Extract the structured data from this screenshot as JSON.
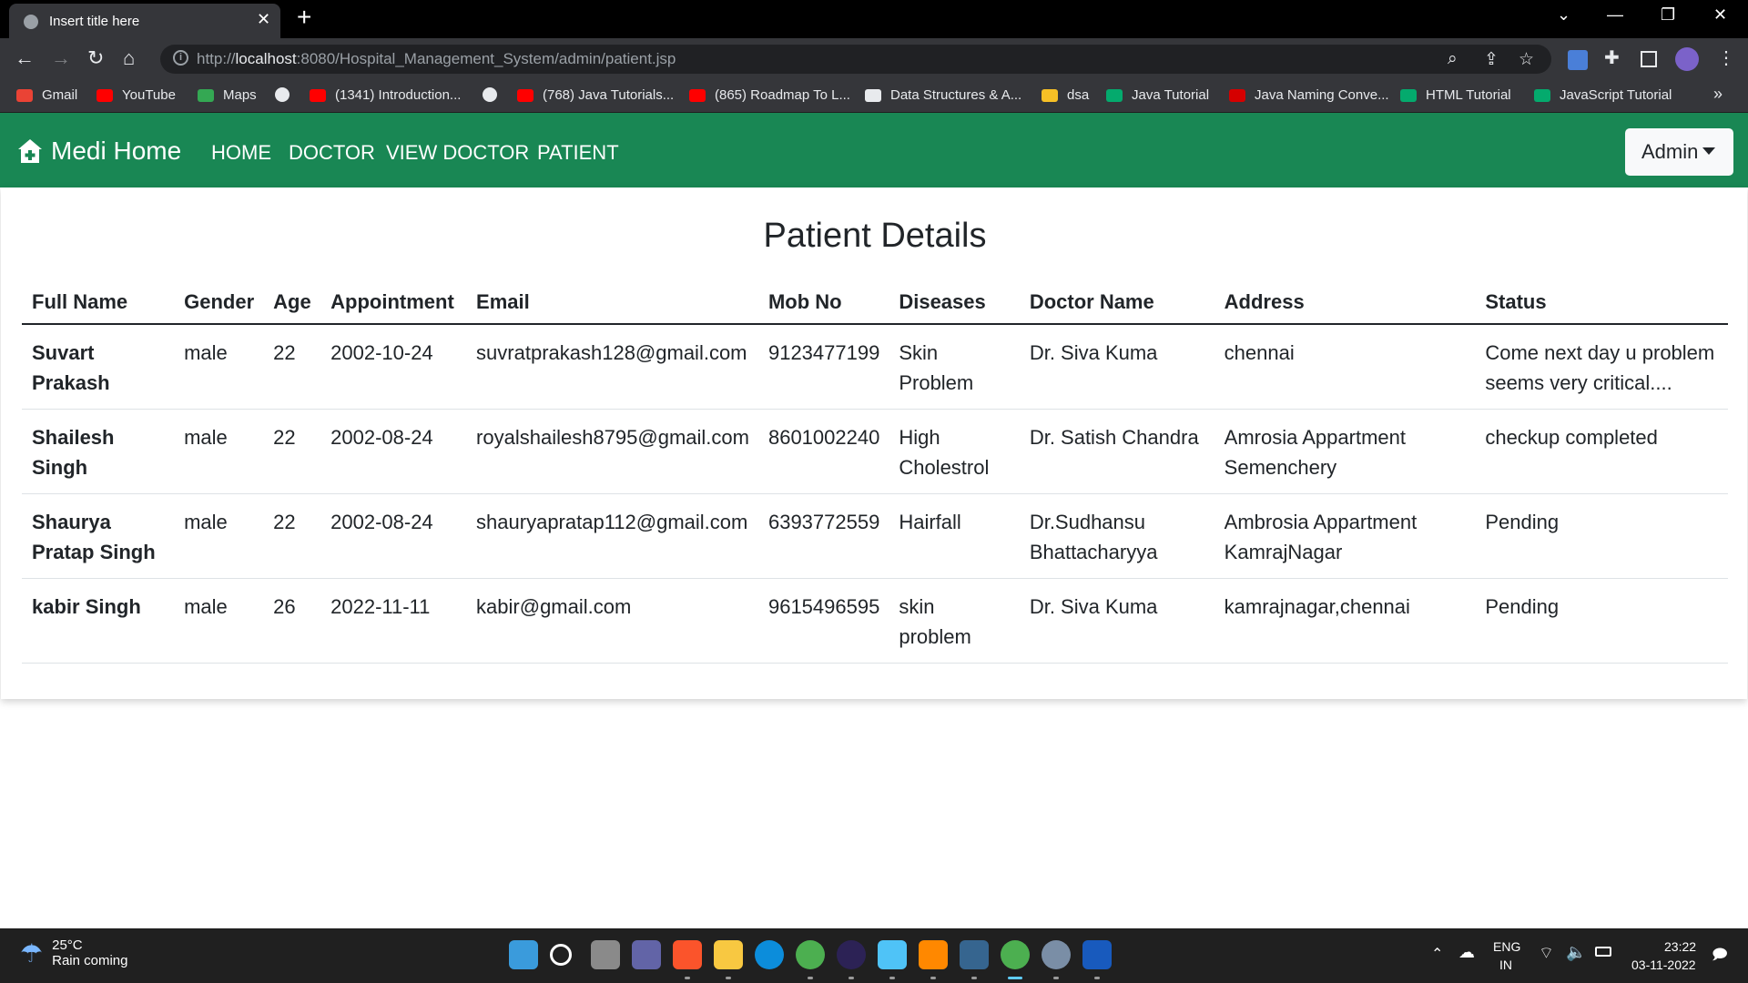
{
  "browser": {
    "tab_title": "Insert title here",
    "url_scheme": "http://",
    "url_host": "localhost",
    "url_rest": ":8080/Hospital_Management_System/admin/patient.jsp",
    "bookmarks": [
      {
        "label": "Gmail",
        "color": "#ea4335"
      },
      {
        "label": "YouTube",
        "color": "#ff0000"
      },
      {
        "label": "Maps",
        "color": "#34a853"
      },
      {
        "label": "",
        "color": "#e8eaed"
      },
      {
        "label": "(1341) Introduction...",
        "color": "#ff0000"
      },
      {
        "label": "",
        "color": "#e8eaed"
      },
      {
        "label": "(768) Java Tutorials...",
        "color": "#ff0000"
      },
      {
        "label": "(865) Roadmap To L...",
        "color": "#ff0000"
      },
      {
        "label": "Data Structures & A...",
        "color": "#e8eaed"
      },
      {
        "label": "dsa",
        "color": "#f6c026"
      },
      {
        "label": "Java Tutorial",
        "color": "#04aa6d"
      },
      {
        "label": "Java Naming Conve...",
        "color": "#d50000"
      },
      {
        "label": "HTML Tutorial",
        "color": "#04aa6d"
      },
      {
        "label": "JavaScript Tutorial",
        "color": "#04aa6d"
      }
    ],
    "more_label": "»"
  },
  "navbar": {
    "brand": "Medi Home",
    "links": [
      "HOME",
      "DOCTOR",
      "VIEW DOCTOR",
      "PATIENT"
    ],
    "admin_label": "Admin",
    "color": "#198754"
  },
  "page": {
    "title": "Patient Details",
    "columns": [
      "Full Name",
      "Gender",
      "Age",
      "Appointment",
      "Email",
      "Mob No",
      "Diseases",
      "Doctor Name",
      "Address",
      "Status"
    ],
    "rows": [
      {
        "name": [
          "Suvart",
          "Prakash"
        ],
        "gender": "male",
        "age": "22",
        "appointment": "2002-10-24",
        "email": "suvratprakash128@gmail.com",
        "mob": "9123477199",
        "diseases": [
          "Skin",
          "Problem"
        ],
        "doctor": [
          "Dr. Siva Kuma"
        ],
        "address": [
          "chennai"
        ],
        "status": [
          "Come next day u problem",
          "seems very critical...."
        ]
      },
      {
        "name": [
          "Shailesh",
          "Singh"
        ],
        "gender": "male",
        "age": "22",
        "appointment": "2002-08-24",
        "email": "royalshailesh8795@gmail.com",
        "mob": "8601002240",
        "diseases": [
          "High",
          "Cholestrol"
        ],
        "doctor": [
          "Dr. Satish Chandra"
        ],
        "address": [
          "Amrosia Appartment",
          "Semenchery"
        ],
        "status": [
          "checkup completed"
        ]
      },
      {
        "name": [
          "Shaurya",
          "Pratap Singh"
        ],
        "gender": "male",
        "age": "22",
        "appointment": "2002-08-24",
        "email": "shauryapratap112@gmail.com",
        "mob": "6393772559",
        "diseases": [
          "Hairfall"
        ],
        "doctor": [
          "Dr.Sudhansu",
          "Bhattacharyya"
        ],
        "address": [
          "Ambrosia Appartment",
          "KamrajNagar"
        ],
        "status": [
          "Pending"
        ]
      },
      {
        "name": [
          "kabir Singh"
        ],
        "gender": "male",
        "age": "26",
        "appointment": "2022-11-11",
        "email": "kabir@gmail.com",
        "mob": "9615496595",
        "diseases": [
          "skin",
          "problem"
        ],
        "doctor": [
          "Dr. Siva Kuma"
        ],
        "address": [
          "kamrajnagar,chennai"
        ],
        "status": [
          "Pending"
        ]
      }
    ]
  },
  "taskbar": {
    "weather_temp": "25°C",
    "weather_desc": "Rain coming",
    "apps": [
      {
        "name": "start",
        "color": "#3a9bdc"
      },
      {
        "name": "search",
        "color": "#202020"
      },
      {
        "name": "task-view",
        "color": "#8a8a8a"
      },
      {
        "name": "teams",
        "color": "#6264a7"
      },
      {
        "name": "brave",
        "color": "#fb542b"
      },
      {
        "name": "file-explorer",
        "color": "#f8c841"
      },
      {
        "name": "edge",
        "color": "#0c8ddb"
      },
      {
        "name": "chrome",
        "color": "#4caf50"
      },
      {
        "name": "eclipse",
        "color": "#2c2255"
      },
      {
        "name": "notepad",
        "color": "#4fc3f7"
      },
      {
        "name": "vlc",
        "color": "#ff8800"
      },
      {
        "name": "mysql-workbench",
        "color": "#36658f"
      },
      {
        "name": "chrome-profile",
        "color": "#4caf50"
      },
      {
        "name": "settings",
        "color": "#7a8ea6"
      },
      {
        "name": "word",
        "color": "#185abd"
      }
    ],
    "lang": "ENG",
    "region": "IN",
    "time": "23:22",
    "date": "03-11-2022"
  }
}
